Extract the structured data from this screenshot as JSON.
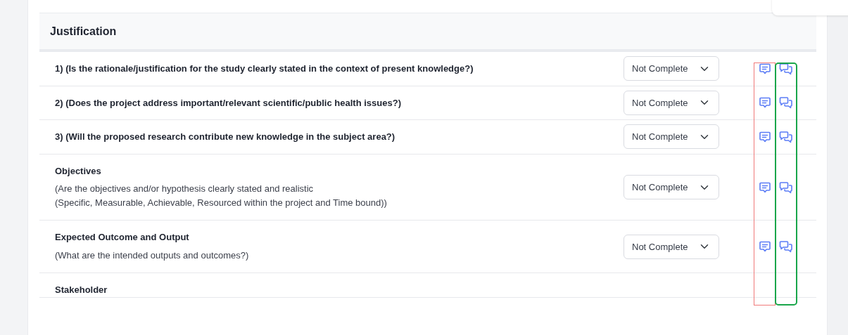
{
  "section": {
    "title": "Justification"
  },
  "rows": [
    {
      "title": "1) (Is the rationale/justification for the study clearly stated in the context of present knowledge?)",
      "status": "Not Complete"
    },
    {
      "title": "2) (Does the project address important/relevant scientific/public health issues?)",
      "status": "Not Complete"
    },
    {
      "title": "3) (Will the proposed research contribute new knowledge in the subject area?)",
      "status": "Not Complete"
    },
    {
      "title": "Objectives",
      "description": [
        "(Are the objectives and/or hypothesis clearly stated and realistic",
        "(Specific, Measurable, Achievable, Resourced within the project and Time bound))"
      ],
      "status": "Not Complete"
    },
    {
      "title": "Expected Outcome and Output",
      "description": [
        "(What are the intended outputs and outcomes?)"
      ],
      "status": "Not Complete"
    },
    {
      "title": "Stakeholder"
    }
  ]
}
